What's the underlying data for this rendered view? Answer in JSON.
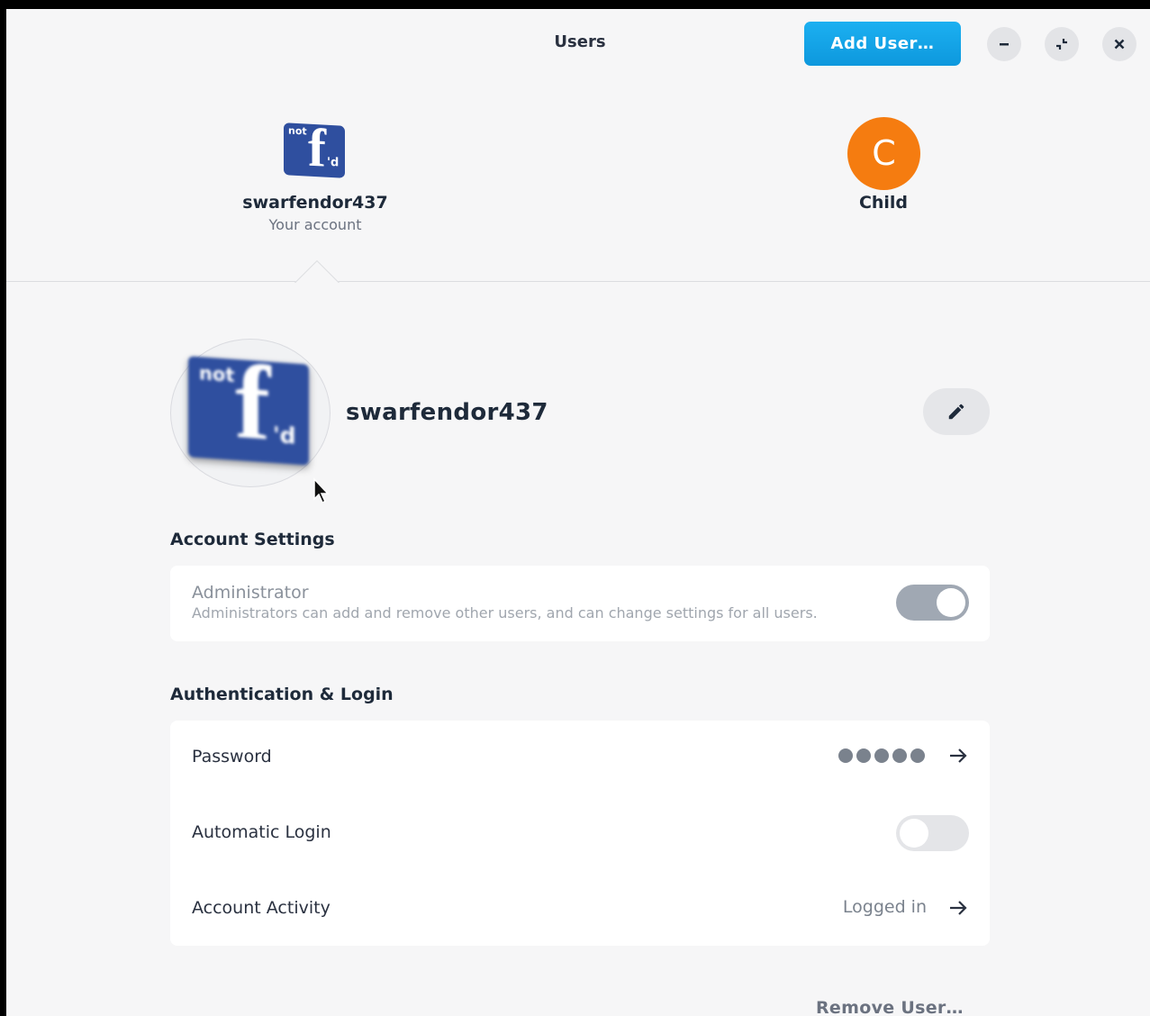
{
  "window": {
    "title": "Users"
  },
  "header": {
    "add_user_label": "Add User…",
    "minimize_icon": "minimize-icon",
    "restore_icon": "restore-icon",
    "close_icon": "close-icon"
  },
  "users": [
    {
      "name": "swarfendor437",
      "subtitle": "Your account",
      "avatar": "not f'd logo",
      "selected": true
    },
    {
      "name": "Child",
      "subtitle": "",
      "avatar_initial": "C",
      "avatar_color": "#f57c10",
      "selected": false
    }
  ],
  "logo": {
    "top": "not",
    "main": "f",
    "bottom": "'d",
    "color": "#2f4f9f"
  },
  "profile": {
    "name": "swarfendor437",
    "edit_icon": "pencil-icon"
  },
  "account_settings": {
    "title": "Account Settings",
    "administrator": {
      "label": "Administrator",
      "description": "Administrators can add and remove other users, and can change settings for all users.",
      "enabled": true
    }
  },
  "auth": {
    "title": "Authentication & Login",
    "password": {
      "label": "Password",
      "value_dots": 5
    },
    "automatic_login": {
      "label": "Automatic Login",
      "enabled": false
    },
    "account_activity": {
      "label": "Account Activity",
      "value": "Logged in"
    }
  },
  "remove_user_label": "Remove User…",
  "colors": {
    "accent": "#11a3e6",
    "child_avatar": "#f57c10",
    "background": "#f6f6f7"
  }
}
